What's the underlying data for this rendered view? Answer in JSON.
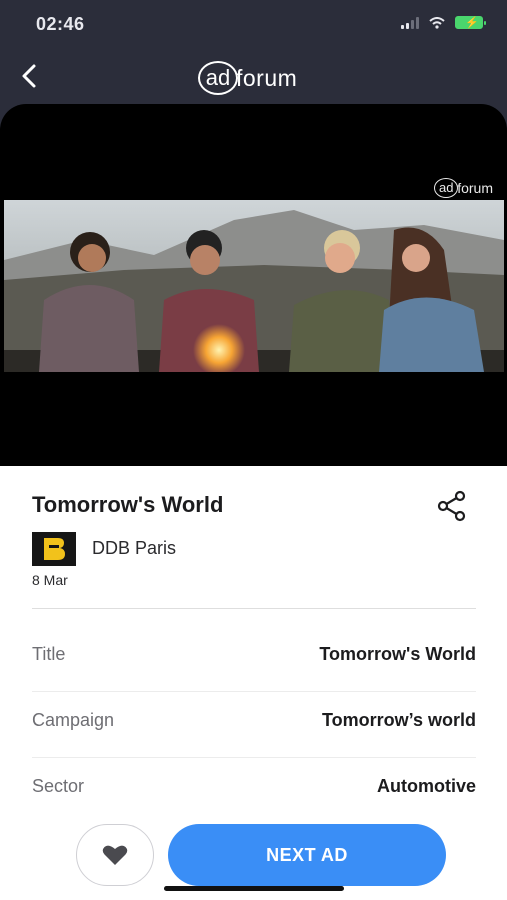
{
  "status_bar": {
    "time": "02:46"
  },
  "header": {
    "logo_ad": "ad",
    "logo_forum": "forum"
  },
  "video": {
    "watermark_ad": "ad",
    "watermark_forum": "forum"
  },
  "ad": {
    "title": "Tomorrow's World",
    "agency": "DDB Paris",
    "agency_logo_letter": "B",
    "date": "8 Mar"
  },
  "details": [
    {
      "label": "Title",
      "value": "Tomorrow's World"
    },
    {
      "label": "Campaign",
      "value": "Tomorrow’s world"
    },
    {
      "label": "Sector",
      "value": "Automotive"
    }
  ],
  "actions": {
    "next_label": "NEXT AD"
  },
  "icons": {
    "back": "chevron-left-icon",
    "share": "share-icon",
    "favorite": "heart-icon"
  },
  "colors": {
    "accent": "#3a8ef6",
    "header_bg": "#2b2d3a",
    "agency_logo": "#f2c21b"
  }
}
